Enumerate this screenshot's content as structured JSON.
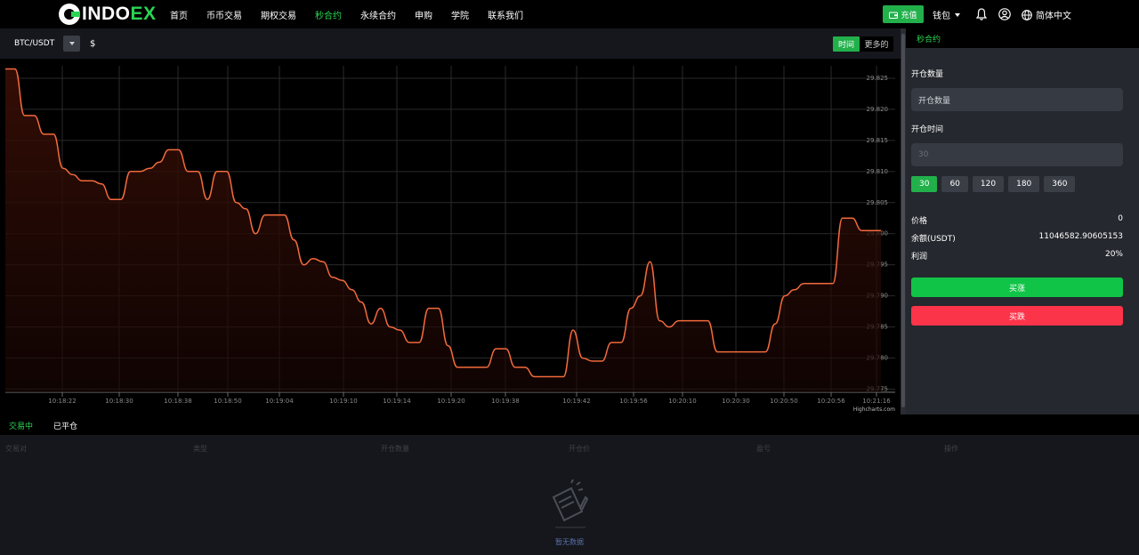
{
  "brand": {
    "logo_left": "INDO",
    "logo_right": "EX"
  },
  "nav": {
    "items": [
      "首页",
      "币币交易",
      "期权交易",
      "秒合约",
      "永续合约",
      "申购",
      "学院",
      "联系我们"
    ],
    "active_index": 3
  },
  "header": {
    "deposit_label": "充值",
    "wallet_label": "钱包",
    "language_label": "简体中文"
  },
  "subbar": {
    "pair": "BTC/USDT",
    "currency_symbol": "$",
    "tab_time": "时间",
    "tab_more": "更多的"
  },
  "chart_data": {
    "type": "area",
    "series_color": "#f26a3c",
    "x_labels": [
      "10:18:22",
      "10:18:30",
      "10:18:38",
      "10:18:50",
      "10:19:04",
      "10:19:10",
      "10:19:14",
      "10:19:20",
      "10:19:38",
      "10:19:42",
      "10:19:56",
      "10:20:10",
      "10:20:30",
      "10:20:50",
      "10:20:56",
      "10:21:16"
    ],
    "y_ticks": [
      "29.825",
      "29.820",
      "29.815",
      "29.810",
      "29.805",
      "29.800",
      "29.795",
      "29.790",
      "29.785",
      "29.780",
      "29.775"
    ],
    "ylim": [
      29.775,
      29.825
    ],
    "credit": "Highcharts.com",
    "values": [
      29.8265,
      29.8265,
      29.819,
      29.819,
      29.816,
      29.816,
      29.8105,
      29.8095,
      29.8085,
      29.8085,
      29.808,
      29.8055,
      29.8055,
      29.81,
      29.81,
      29.8105,
      29.8115,
      29.8135,
      29.8135,
      29.81,
      29.81,
      29.8055,
      29.81,
      29.81,
      29.805,
      29.804,
      29.8,
      29.803,
      29.803,
      29.803,
      29.799,
      29.795,
      29.796,
      29.7955,
      29.793,
      29.7925,
      29.791,
      29.789,
      29.7855,
      29.788,
      29.785,
      29.7845,
      29.7825,
      29.7825,
      29.788,
      29.788,
      29.782,
      29.7785,
      29.7785,
      29.7785,
      29.7785,
      29.7815,
      29.7815,
      29.7785,
      29.7785,
      29.777,
      29.777,
      29.777,
      29.777,
      29.7845,
      29.78,
      29.7795,
      29.7795,
      29.7825,
      29.7825,
      29.788,
      29.79,
      29.7955,
      29.786,
      29.785,
      29.786,
      29.786,
      29.786,
      29.786,
      29.781,
      29.781,
      29.781,
      29.781,
      29.781,
      29.781,
      29.7855,
      29.79,
      29.791,
      29.792,
      29.792,
      29.792,
      29.792,
      29.8025,
      29.8025,
      29.8005,
      29.8005,
      29.8005
    ]
  },
  "panel": {
    "title": "秒合约",
    "qty_label": "开仓数量",
    "qty_placeholder": "开仓数量",
    "time_label": "开仓时间",
    "time_value": "30",
    "time_options": [
      "30",
      "60",
      "120",
      "180",
      "360"
    ],
    "price_label": "价格",
    "price_value": "0",
    "balance_label": "余额(USDT)",
    "balance_value": "11046582.90605153",
    "profit_label": "利润",
    "profit_value": "20%",
    "buy_label": "买涨",
    "sell_label": "买跌"
  },
  "orders": {
    "tab_active": "交易中",
    "tab_closed": "已平仓",
    "columns": [
      "交易对",
      "类型",
      "开仓数量",
      "开仓价",
      "盈亏",
      "操作"
    ],
    "empty_text": "暂无数据"
  }
}
